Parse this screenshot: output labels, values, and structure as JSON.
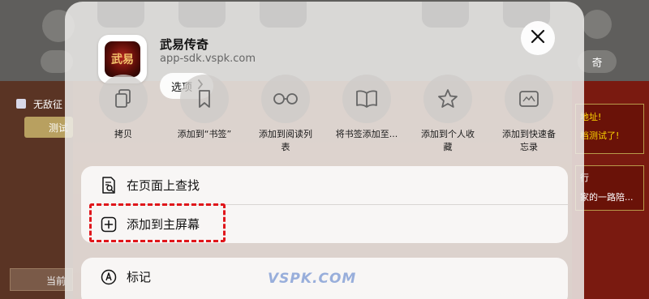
{
  "background": {
    "left_checkbox_label": "无敌征",
    "left_button_label": "测试",
    "bottom_button_label": "当前",
    "top_right_pill_label": "奇",
    "right_panel": {
      "line1": "地址!",
      "line2": "档测试了!",
      "line3": "行",
      "line4": "家的一路陪..."
    }
  },
  "share_sheet": {
    "app": {
      "title": "武易传奇",
      "url": "app-sdk.vspk.com",
      "icon_text": "武易",
      "icon_name": "app-icon"
    },
    "options_label": "选项",
    "actions": [
      {
        "label": "拷贝",
        "icon": "copy-icon"
      },
      {
        "label": "添加到“书签”",
        "icon": "bookmark-icon"
      },
      {
        "label": "添加到阅读列表",
        "icon": "reading-glasses-icon"
      },
      {
        "label": "将书签添加至...",
        "icon": "book-icon"
      },
      {
        "label": "添加到个人收藏",
        "icon": "star-icon"
      },
      {
        "label": "添加到快速备忘录",
        "icon": "quick-note-icon"
      }
    ],
    "menu_group_1": [
      {
        "label": "在页面上查找",
        "icon": "find-on-page-icon"
      },
      {
        "label": "添加到主屏幕",
        "icon": "add-square-icon"
      }
    ],
    "menu_group_2": [
      {
        "label": "标记",
        "icon": "markup-icon"
      }
    ]
  },
  "watermark": "VSPK.COM",
  "colors": {
    "highlight": "#e0161b",
    "sheet": "#eeecea"
  }
}
